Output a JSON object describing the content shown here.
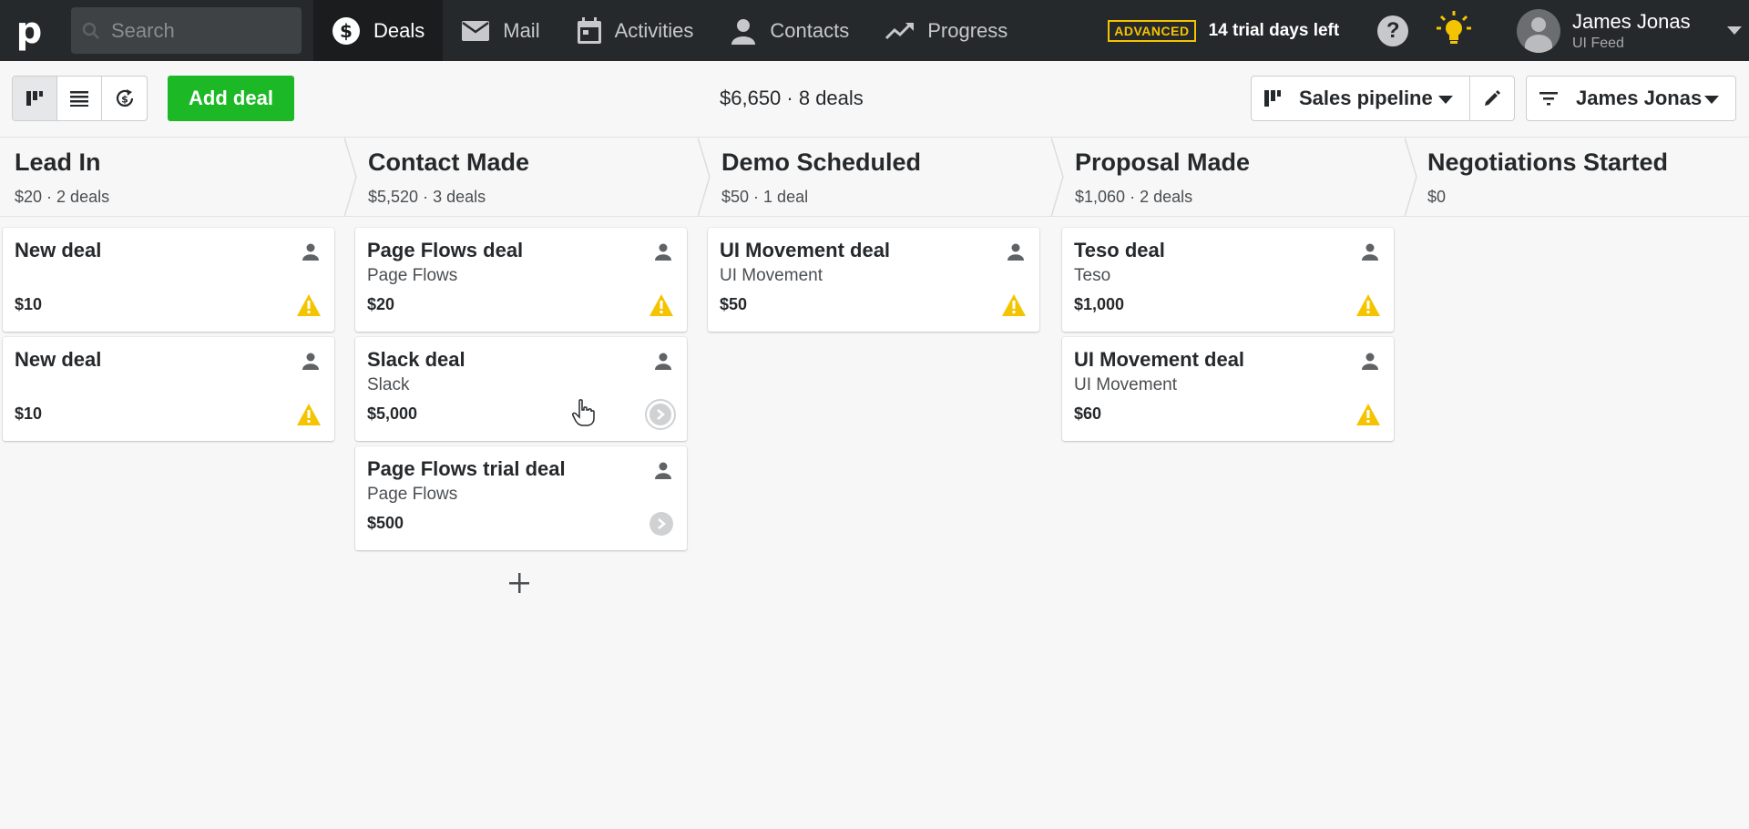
{
  "nav": {
    "logo": "p",
    "search_placeholder": "Search",
    "items": [
      {
        "label": "Deals",
        "icon": "dollar-circle-icon"
      },
      {
        "label": "Mail",
        "icon": "mail-icon"
      },
      {
        "label": "Activities",
        "icon": "calendar-icon"
      },
      {
        "label": "Contacts",
        "icon": "person-icon"
      },
      {
        "label": "Progress",
        "icon": "trend-up-icon"
      }
    ],
    "badge": "ADVANCED",
    "trial": "14 trial days left",
    "help": "?",
    "user": {
      "name": "James Jonas",
      "company": "UI Feed"
    }
  },
  "toolbar": {
    "add_deal": "Add deal",
    "summary": "$6,650 · 8 deals",
    "pipeline": "Sales pipeline",
    "owner": "James Jonas"
  },
  "stages": [
    {
      "title": "Lead In",
      "value": "$20",
      "count": "2 deals"
    },
    {
      "title": "Contact Made",
      "value": "$5,520",
      "count": "3 deals"
    },
    {
      "title": "Demo Scheduled",
      "value": "$50",
      "count": "1 deal"
    },
    {
      "title": "Proposal Made",
      "value": "$1,060",
      "count": "2 deals"
    },
    {
      "title": "Negotiations Started",
      "value": "$0",
      "count": ""
    }
  ],
  "columns": [
    [
      {
        "title": "New deal",
        "org": "",
        "value": "$10",
        "status": "warning"
      },
      {
        "title": "New deal",
        "org": "",
        "value": "$10",
        "status": "warning"
      }
    ],
    [
      {
        "title": "Page Flows deal",
        "org": "Page Flows",
        "value": "$20",
        "status": "warning"
      },
      {
        "title": "Slack deal",
        "org": "Slack",
        "value": "$5,000",
        "status": "next-hover"
      },
      {
        "title": "Page Flows trial deal",
        "org": "Page Flows",
        "value": "$500",
        "status": "next"
      }
    ],
    [
      {
        "title": "UI Movement deal",
        "org": "UI Movement",
        "value": "$50",
        "status": "warning"
      }
    ],
    [
      {
        "title": "Teso deal",
        "org": "Teso",
        "value": "$1,000",
        "status": "warning"
      },
      {
        "title": "UI Movement deal",
        "org": "UI Movement",
        "value": "$60",
        "status": "warning"
      }
    ]
  ],
  "colors": {
    "brand_green": "#1cb826",
    "nav_bg": "#26292c",
    "warning": "#f5c400"
  }
}
